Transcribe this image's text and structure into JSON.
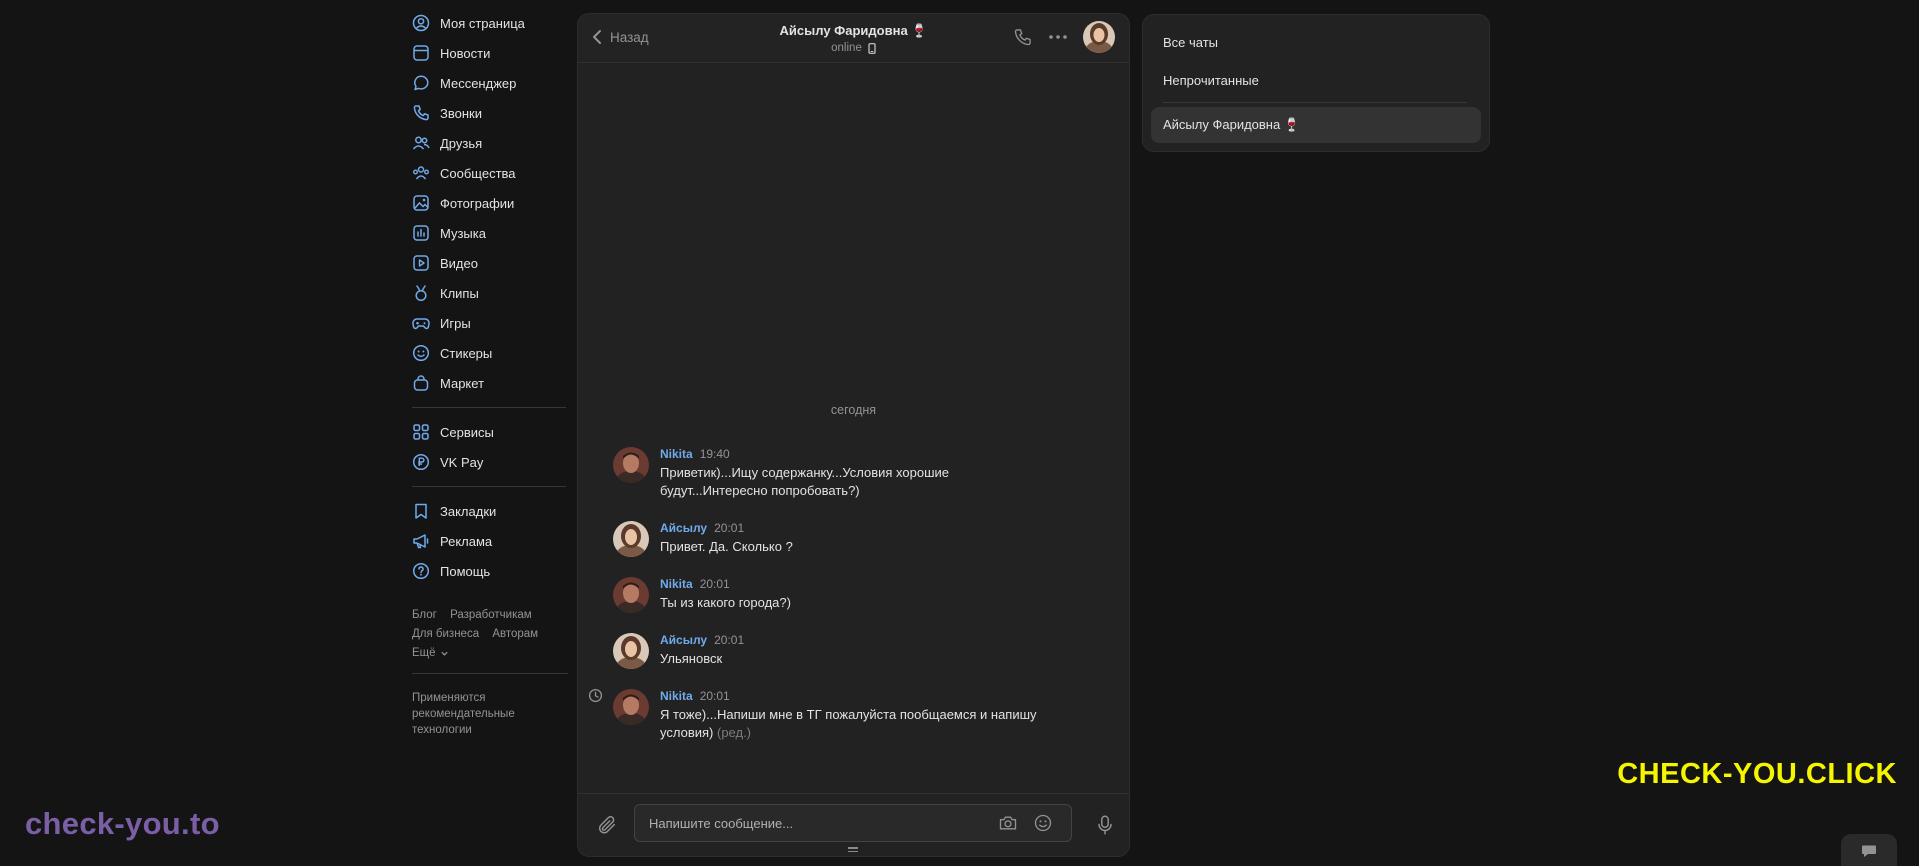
{
  "sidebar": {
    "items": [
      {
        "label": "Моя страница",
        "icon": "user-circle-icon"
      },
      {
        "label": "Новости",
        "icon": "news-icon"
      },
      {
        "label": "Мессенджер",
        "icon": "message-icon"
      },
      {
        "label": "Звонки",
        "icon": "phone-icon"
      },
      {
        "label": "Друзья",
        "icon": "friends-icon"
      },
      {
        "label": "Сообщества",
        "icon": "communities-icon"
      },
      {
        "label": "Фотографии",
        "icon": "photo-icon"
      },
      {
        "label": "Музыка",
        "icon": "music-icon"
      },
      {
        "label": "Видео",
        "icon": "video-icon"
      },
      {
        "label": "Клипы",
        "icon": "clips-icon"
      },
      {
        "label": "Игры",
        "icon": "gamepad-icon"
      },
      {
        "label": "Стикеры",
        "icon": "smile-icon"
      },
      {
        "label": "Маркет",
        "icon": "bag-icon"
      }
    ],
    "items2": [
      {
        "label": "Сервисы",
        "icon": "grid-icon"
      },
      {
        "label": "VK Pay",
        "icon": "ruble-icon"
      }
    ],
    "items3": [
      {
        "label": "Закладки",
        "icon": "bookmark-icon"
      },
      {
        "label": "Реклама",
        "icon": "megaphone-icon"
      },
      {
        "label": "Помощь",
        "icon": "help-icon"
      }
    ],
    "footer": {
      "blog": "Блог",
      "developers": "Разработчикам",
      "business": "Для бизнеса",
      "authors": "Авторам",
      "more": "Ещё"
    },
    "recommend": [
      "Применяются",
      "рекомендательные",
      "технологии"
    ]
  },
  "chat": {
    "back_label": "Назад",
    "peer_name": "Айсылу Фаридовна 🍷",
    "peer_status": "online",
    "date_separator": "сегодня",
    "messages": [
      {
        "author": "Nikita",
        "time": "19:40",
        "lines": [
          "Приветик)...Ищу содержанку...Условия хорошие",
          "будут...Интересно попробовать?)"
        ]
      },
      {
        "author": "Айсылу",
        "time": "20:01",
        "lines": [
          "Привет. Да. Сколько ?"
        ]
      },
      {
        "author": "Nikita",
        "time": "20:01",
        "lines": [
          "Ты из какого города?)"
        ]
      },
      {
        "author": "Айсылу",
        "time": "20:01",
        "lines": [
          "Ульяновск"
        ]
      },
      {
        "author": "Nikita",
        "time": "20:01",
        "lines": [
          "Я тоже)...Напиши мне в ТГ пожалуйста пообщаемся и напишу",
          "условия)"
        ],
        "edited": "(ред.)"
      }
    ],
    "composer_placeholder": "Напишите сообщение..."
  },
  "filters": {
    "all": "Все чаты",
    "unread": "Непрочитанные",
    "active_chat": "Айсылу Фаридовна 🍷"
  },
  "watermarks": {
    "right": "CHECK-YOU.CLICK",
    "left": "check-you.to"
  },
  "colors": {
    "background": "#141414",
    "panel": "#222222",
    "accent": "#71aaeb",
    "watermark_right": "#f5f500",
    "watermark_left": "#7b5fa6"
  }
}
